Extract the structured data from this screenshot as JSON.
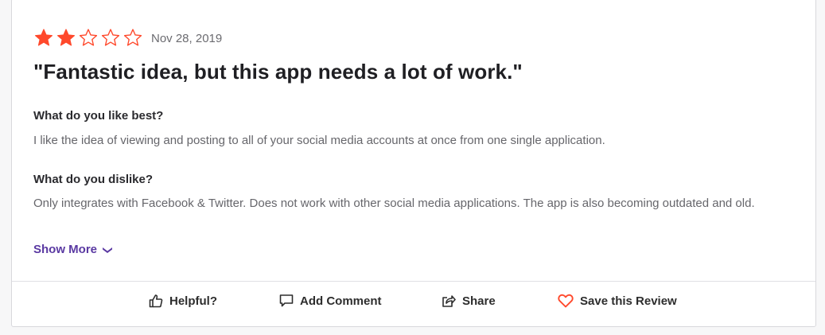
{
  "review": {
    "rating": 2,
    "max_rating": 5,
    "date": "Nov 28, 2019",
    "title": "\"Fantastic idea, but this app needs a lot of work.\"",
    "questions": [
      {
        "label": "What do you like best?",
        "answer": "I like the idea of viewing and posting to all of your social media accounts at once from one single application."
      },
      {
        "label": "What do you dislike?",
        "answer": "Only integrates with Facebook & Twitter. Does not work with other social media applications. The app is also becoming outdated and old."
      }
    ],
    "show_more_label": "Show More"
  },
  "actions": {
    "helpful": "Helpful?",
    "add_comment": "Add Comment",
    "share": "Share",
    "save": "Save this Review"
  },
  "colors": {
    "star_filled": "#ff492c",
    "accent": "#5a39a2",
    "heart": "#ff492c"
  },
  "icons": {
    "helpful": "thumbs-up-icon",
    "add_comment": "comment-icon",
    "share": "share-icon",
    "save": "heart-icon",
    "show_more": "chevron-down-icon",
    "star": "star-icon"
  }
}
